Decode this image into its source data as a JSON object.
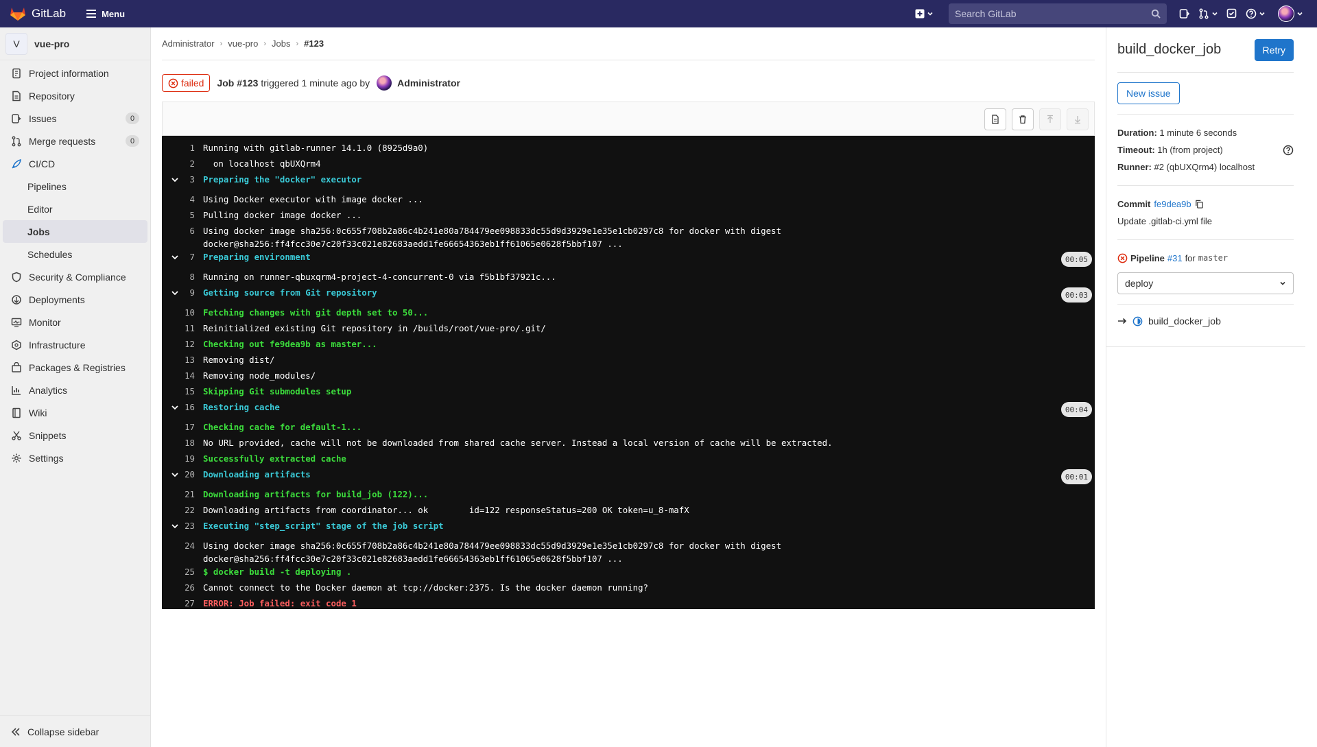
{
  "topbar": {
    "brand": "GitLab",
    "menu_label": "Menu",
    "search_placeholder": "Search GitLab"
  },
  "sidebar": {
    "project_initial": "V",
    "project_name": "vue-pro",
    "items": [
      {
        "label": "Project information",
        "icon": "info-icon"
      },
      {
        "label": "Repository",
        "icon": "doc-icon"
      },
      {
        "label": "Issues",
        "icon": "issues-icon",
        "count": "0"
      },
      {
        "label": "Merge requests",
        "icon": "merge-icon",
        "count": "0"
      },
      {
        "label": "CI/CD",
        "icon": "rocket-icon"
      },
      {
        "label": "Pipelines",
        "sub": true
      },
      {
        "label": "Editor",
        "sub": true
      },
      {
        "label": "Jobs",
        "sub": true,
        "active": true
      },
      {
        "label": "Schedules",
        "sub": true
      },
      {
        "label": "Security & Compliance",
        "icon": "shield-icon"
      },
      {
        "label": "Deployments",
        "icon": "deploy-icon"
      },
      {
        "label": "Monitor",
        "icon": "monitor-icon"
      },
      {
        "label": "Infrastructure",
        "icon": "cloud-icon"
      },
      {
        "label": "Packages & Registries",
        "icon": "package-icon"
      },
      {
        "label": "Analytics",
        "icon": "chart-icon"
      },
      {
        "label": "Wiki",
        "icon": "book-icon"
      },
      {
        "label": "Snippets",
        "icon": "scissors-icon"
      },
      {
        "label": "Settings",
        "icon": "gear-icon"
      }
    ],
    "collapse_label": "Collapse sidebar"
  },
  "breadcrumb": [
    "Administrator",
    "vue-pro",
    "Jobs",
    "#123"
  ],
  "job_header": {
    "status": "failed",
    "job_label": "Job #123",
    "triggered": "triggered 1 minute ago by",
    "user": "Administrator"
  },
  "log": [
    {
      "n": "1",
      "text": "Running with gitlab-runner 14.1.0 (8925d9a0)"
    },
    {
      "n": "2",
      "text": "  on localhost qbUXQrm4"
    },
    {
      "n": "3",
      "text": "Preparing the \"docker\" executor",
      "section": true
    },
    {
      "n": "4",
      "text": "Using Docker executor with image docker ..."
    },
    {
      "n": "5",
      "text": "Pulling docker image docker ..."
    },
    {
      "n": "6",
      "text": "Using docker image sha256:0c655f708b2a86c4b241e80a784479ee098833dc55d9d3929e1e35e1cb0297c8 for docker with digest docker@sha256:ff4fcc30e7c20f33c021e82683aedd1fe66654363eb1ff61065e0628f5bbf107 ...",
      "wrap": true
    },
    {
      "n": "7",
      "text": "Preparing environment",
      "section": true,
      "duration": "00:05"
    },
    {
      "n": "8",
      "text": "Running on runner-qbuxqrm4-project-4-concurrent-0 via f5b1bf37921c..."
    },
    {
      "n": "9",
      "text": "Getting source from Git repository",
      "section": true,
      "duration": "00:03"
    },
    {
      "n": "10",
      "text": "Fetching changes with git depth set to 50...",
      "color": "green"
    },
    {
      "n": "11",
      "text": "Reinitialized existing Git repository in /builds/root/vue-pro/.git/"
    },
    {
      "n": "12",
      "text": "Checking out fe9dea9b as master...",
      "color": "green"
    },
    {
      "n": "13",
      "text": "Removing dist/"
    },
    {
      "n": "14",
      "text": "Removing node_modules/"
    },
    {
      "n": "15",
      "text": "Skipping Git submodules setup",
      "color": "green"
    },
    {
      "n": "16",
      "text": "Restoring cache",
      "section": true,
      "duration": "00:04"
    },
    {
      "n": "17",
      "text": "Checking cache for default-1...",
      "color": "green"
    },
    {
      "n": "18",
      "text": "No URL provided, cache will not be downloaded from shared cache server. Instead a local version of cache will be extracted."
    },
    {
      "n": "19",
      "text": "Successfully extracted cache",
      "color": "green"
    },
    {
      "n": "20",
      "text": "Downloading artifacts",
      "section": true,
      "duration": "00:01"
    },
    {
      "n": "21",
      "text": "Downloading artifacts for build_job (122)...",
      "color": "green"
    },
    {
      "n": "22",
      "text": "Downloading artifacts from coordinator... ok        id=122 responseStatus=200 OK token=u_8-mafX"
    },
    {
      "n": "23",
      "text": "Executing \"step_script\" stage of the job script",
      "section": true
    },
    {
      "n": "24",
      "text": "Using docker image sha256:0c655f708b2a86c4b241e80a784479ee098833dc55d9d3929e1e35e1cb0297c8 for docker with digest docker@sha256:ff4fcc30e7c20f33c021e82683aedd1fe66654363eb1ff61065e0628f5bbf107 ...",
      "wrap": true
    },
    {
      "n": "25",
      "text": "$ docker build -t deploying .",
      "color": "green"
    },
    {
      "n": "26",
      "text": "Cannot connect to the Docker daemon at tcp://docker:2375. Is the docker daemon running?"
    },
    {
      "n": "27",
      "text": "ERROR: Job failed: exit code 1",
      "color": "red"
    }
  ],
  "right": {
    "title": "build_docker_job",
    "retry": "Retry",
    "new_issue": "New issue",
    "duration_label": "Duration:",
    "duration": "1 minute 6 seconds",
    "timeout_label": "Timeout:",
    "timeout": "1h (from project)",
    "runner_label": "Runner:",
    "runner": "#2 (qbUXQrm4) localhost",
    "commit_label": "Commit",
    "commit_sha": "fe9dea9b",
    "commit_msg": "Update .gitlab-ci.yml file",
    "pipeline_label": "Pipeline",
    "pipeline_id": "#31",
    "pipeline_for": "for",
    "pipeline_ref": "master",
    "stage": "deploy",
    "job_name": "build_docker_job"
  }
}
